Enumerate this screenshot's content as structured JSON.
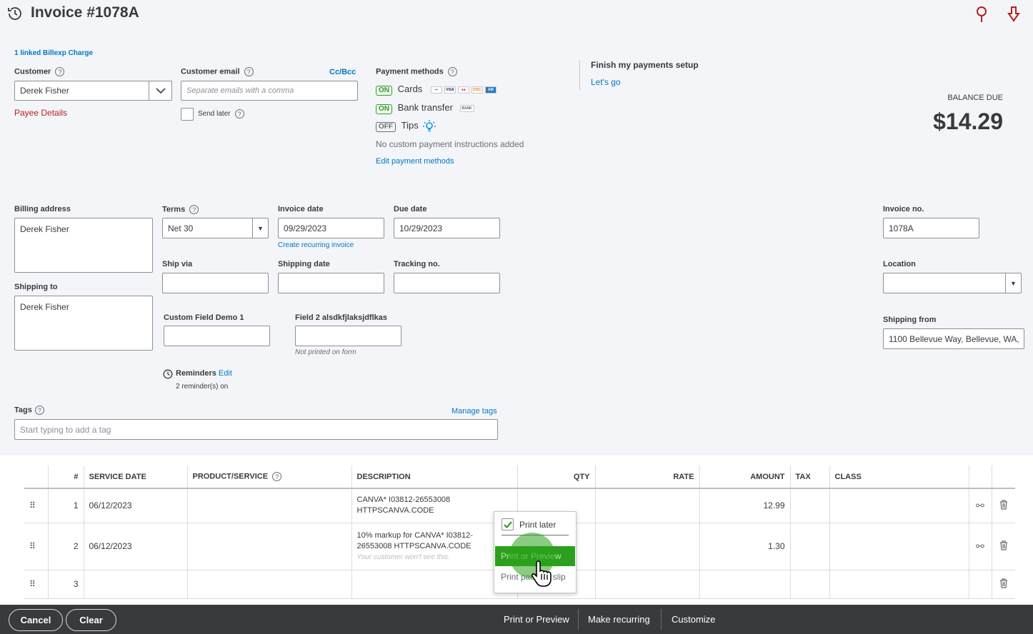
{
  "header": {
    "title": "Invoice #1078A",
    "history_icon": "history-clock-icon",
    "help_icon": "help-pin-icon",
    "download_icon": "download-arrow-icon"
  },
  "linked_charge": "1 linked Billexp Charge",
  "customer": {
    "label": "Customer",
    "value": "Derek Fisher",
    "payee_link": "Payee Details"
  },
  "email": {
    "label": "Customer email",
    "cc_link": "Cc/Bcc",
    "placeholder": "Separate emails with a comma",
    "send_later": "Send later"
  },
  "payment": {
    "label": "Payment methods",
    "methods": [
      {
        "state": "ON",
        "label": "Cards"
      },
      {
        "state": "ON",
        "label": "Bank transfer"
      },
      {
        "state": "OFF",
        "label": "Tips"
      }
    ],
    "note": "No custom payment instructions added",
    "edit_link": "Edit payment methods"
  },
  "setup": {
    "title": "Finish my payments setup",
    "link": "Let's go"
  },
  "balance": {
    "label": "BALANCE DUE",
    "amount": "$14.29"
  },
  "billing": {
    "label": "Billing address",
    "value": "Derek Fisher"
  },
  "shipping_to": {
    "label": "Shipping to",
    "value": "Derek Fisher"
  },
  "terms": {
    "label": "Terms",
    "value": "Net 30"
  },
  "invoice_date": {
    "label": "Invoice date",
    "value": "09/29/2023",
    "recurring_link": "Create recurring invoice"
  },
  "due_date": {
    "label": "Due date",
    "value": "10/29/2023"
  },
  "ship_via": {
    "label": "Ship via"
  },
  "shipping_date": {
    "label": "Shipping date"
  },
  "tracking": {
    "label": "Tracking no."
  },
  "custom1": {
    "label": "Custom Field Demo 1"
  },
  "custom2": {
    "label": "Field 2 alsdkfjlaksjdflkas",
    "note": "Not printed on form"
  },
  "reminders": {
    "label": "Reminders",
    "edit": "Edit",
    "status": "2 reminder(s) on"
  },
  "invoice_no": {
    "label": "Invoice no.",
    "value": "1078A"
  },
  "location": {
    "label": "Location",
    "value": ""
  },
  "shipping_from": {
    "label": "Shipping from",
    "value": "1100 Bellevue Way, Bellevue, WA,"
  },
  "tags": {
    "label": "Tags",
    "manage": "Manage tags",
    "placeholder": "Start typing to add a tag"
  },
  "table": {
    "headers": {
      "num": "#",
      "service_date": "SERVICE DATE",
      "product": "PRODUCT/SERVICE",
      "description": "DESCRIPTION",
      "qty": "QTY",
      "rate": "RATE",
      "amount": "AMOUNT",
      "tax": "TAX",
      "class": "CLASS"
    },
    "rows": [
      {
        "num": "1",
        "date": "06/12/2023",
        "desc1": "CANVA* I03812-26553008",
        "desc2": "HTTPSCANVA.CODE",
        "amount": "12.99"
      },
      {
        "num": "2",
        "date": "06/12/2023",
        "desc1": "10% markup for CANVA* I03812-",
        "desc2": "26553008 HTTPSCANVA.CODE",
        "desc3": "Your customer won't see this.",
        "amount": "1.30"
      },
      {
        "num": "3",
        "date": "",
        "amount": ""
      }
    ]
  },
  "popup": {
    "print_later": "Print later",
    "print_preview": "Print or Preview",
    "packing_slip": "Print packing slip"
  },
  "footer": {
    "cancel": "Cancel",
    "clear": "Clear",
    "print_preview": "Print or Preview",
    "make_recurring": "Make recurring",
    "customize": "Customize"
  },
  "colors": {
    "accent_green": "#2ca01c",
    "link_blue": "#0077c5",
    "danger_red": "#b51f1f",
    "footer_bg": "#393a3d"
  }
}
